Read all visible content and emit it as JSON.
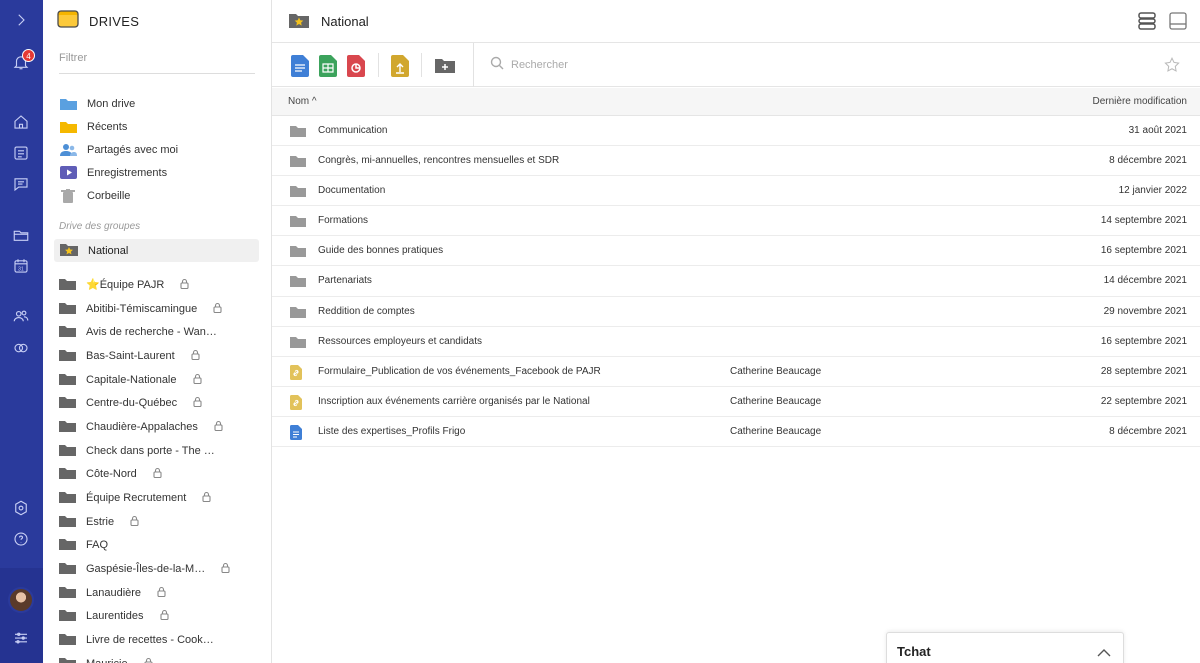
{
  "rail": {
    "notification_count": "4",
    "icons": [
      "chevron-right-icon",
      "bell-icon",
      "home-icon",
      "news-icon",
      "chat-icon",
      "drive-icon",
      "calendar-icon",
      "people-icon",
      "circles-icon",
      "settings-icon",
      "help-icon",
      "avatar",
      "sliders-icon"
    ]
  },
  "drives": {
    "title": "DRIVES",
    "filter_placeholder": "Filtrer",
    "nav": [
      {
        "label": "Mon drive",
        "icon": "folder-blue-icon"
      },
      {
        "label": "Récents",
        "icon": "folder-yellow-icon"
      },
      {
        "label": "Partagés avec moi",
        "icon": "shared-users-icon"
      },
      {
        "label": "Enregistrements",
        "icon": "video-icon"
      },
      {
        "label": "Corbeille",
        "icon": "trash-icon"
      }
    ],
    "group_section_label": "Drive des groupes",
    "active_group": "National",
    "groups": [
      {
        "label": "⭐Équipe PAJR",
        "locked": true
      },
      {
        "label": "Abitibi-Témiscamingue",
        "locked": true
      },
      {
        "label": "Avis de recherche - Wan…",
        "locked": false
      },
      {
        "label": "Bas-Saint-Laurent",
        "locked": true
      },
      {
        "label": "Capitale-Nationale",
        "locked": true
      },
      {
        "label": "Centre-du-Québec",
        "locked": true
      },
      {
        "label": "Chaudière-Appalaches",
        "locked": true
      },
      {
        "label": "Check dans porte - The …",
        "locked": false
      },
      {
        "label": "Côte-Nord",
        "locked": true
      },
      {
        "label": "Équipe Recrutement",
        "locked": true
      },
      {
        "label": "Estrie",
        "locked": true
      },
      {
        "label": "FAQ",
        "locked": false
      },
      {
        "label": "Gaspésie-Îles-de-la-M…",
        "locked": true
      },
      {
        "label": "Lanaudière",
        "locked": true
      },
      {
        "label": "Laurentides",
        "locked": true
      },
      {
        "label": "Livre de recettes - Cook…",
        "locked": false
      },
      {
        "label": "Mauricie",
        "locked": true
      }
    ]
  },
  "main": {
    "title": "National",
    "search_placeholder": "Rechercher",
    "toolbar_icons": [
      "new-document-icon",
      "new-spreadsheet-icon",
      "new-presentation-icon",
      "upload-icon",
      "new-folder-icon"
    ],
    "columns": {
      "name": "Nom",
      "modified": "Dernière modification"
    },
    "rows": [
      {
        "type": "folder",
        "name": "Communication",
        "owner": "",
        "date": "31 août 2021"
      },
      {
        "type": "folder",
        "name": "Congrès, mi-annuelles, rencontres mensuelles et SDR",
        "owner": "",
        "date": "8 décembre 2021"
      },
      {
        "type": "folder",
        "name": "Documentation",
        "owner": "",
        "date": "12 janvier 2022"
      },
      {
        "type": "folder",
        "name": "Formations",
        "owner": "",
        "date": "14 septembre 2021"
      },
      {
        "type": "folder",
        "name": "Guide des bonnes pratiques",
        "owner": "",
        "date": "16 septembre 2021"
      },
      {
        "type": "folder",
        "name": "Partenariats",
        "owner": "",
        "date": "14 décembre 2021"
      },
      {
        "type": "folder",
        "name": "Reddition de comptes",
        "owner": "",
        "date": "29 novembre 2021"
      },
      {
        "type": "folder",
        "name": "Ressources employeurs et candidats",
        "owner": "",
        "date": "16 septembre 2021"
      },
      {
        "type": "link",
        "name": "Formulaire_Publication de vos événements_Facebook de PAJR",
        "owner": "Catherine Beaucage",
        "date": "28 septembre 2021"
      },
      {
        "type": "link",
        "name": "Inscription aux événements carrière organisés par le National",
        "owner": "Catherine Beaucage",
        "date": "22 septembre 2021"
      },
      {
        "type": "doc",
        "name": "Liste des expertises_Profils Frigo",
        "owner": "Catherine Beaucage",
        "date": "8 décembre 2021"
      }
    ]
  },
  "chat": {
    "label": "Tchat"
  }
}
